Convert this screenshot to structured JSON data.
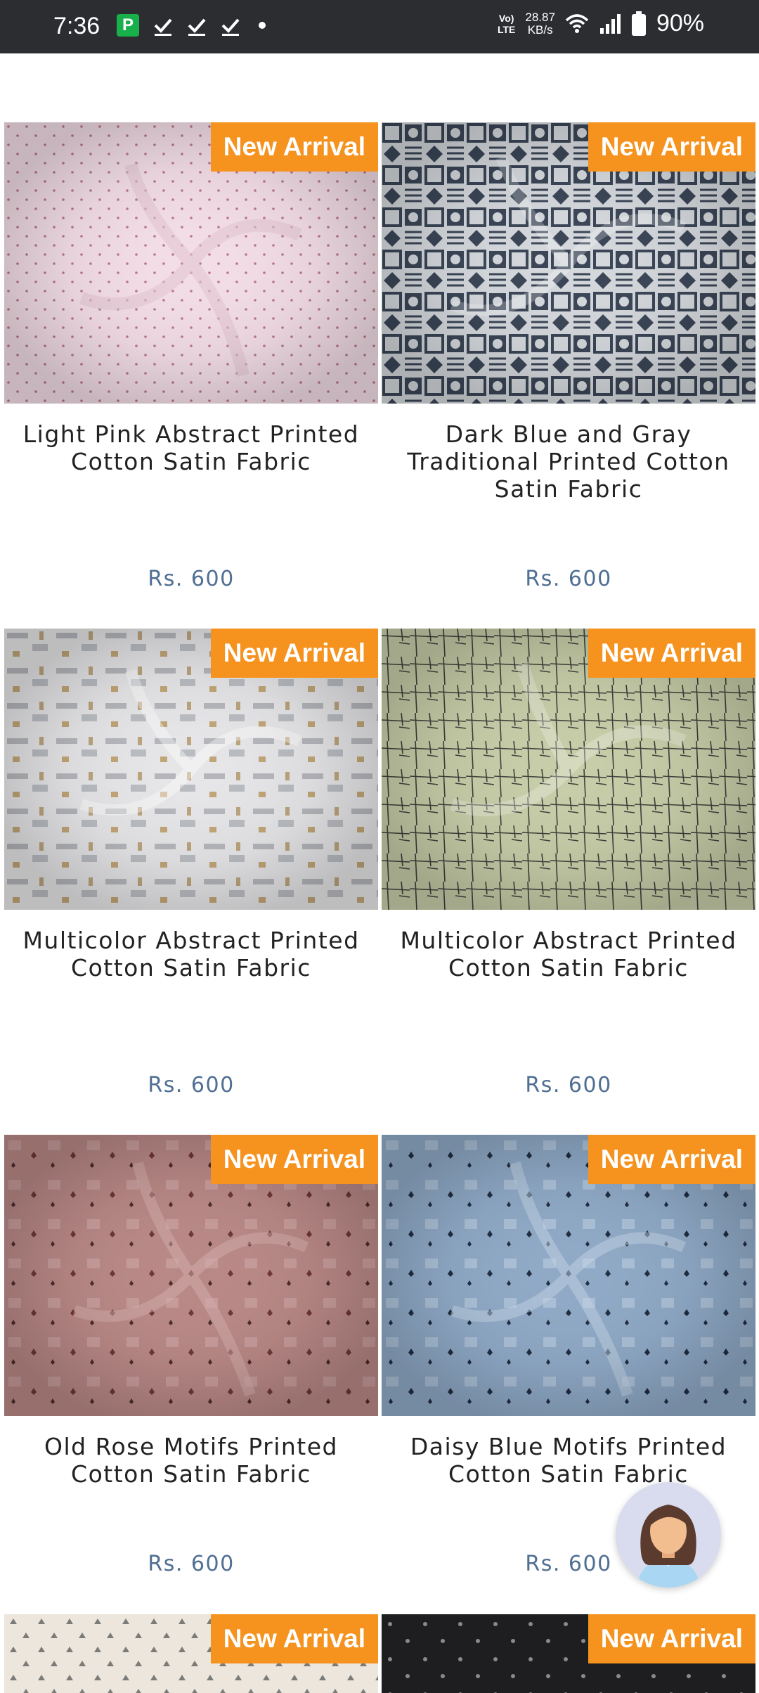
{
  "status_bar": {
    "time": "7:36",
    "app_icon_letter": "P",
    "network_label_top": "Vo)",
    "network_label_bottom": "LTE",
    "speed_value": "28.87",
    "speed_unit": "KB/s",
    "battery": "90%"
  },
  "products": [
    {
      "badge": "New Arrival",
      "title": "Light Pink Abstract Printed Cotton Satin Fabric",
      "price": "Rs. 600"
    },
    {
      "badge": "New Arrival",
      "title": "Dark Blue and Gray Traditional Printed Cotton Satin Fabric",
      "price": "Rs. 600"
    },
    {
      "badge": "New Arrival",
      "title": "Multicolor Abstract Printed Cotton Satin Fabric",
      "price": "Rs. 600"
    },
    {
      "badge": "New Arrival",
      "title": "Multicolor Abstract Printed Cotton Satin Fabric",
      "price": "Rs. 600"
    },
    {
      "badge": "New Arrival",
      "title": "Old Rose Motifs Printed Cotton Satin Fabric",
      "price": "Rs. 600"
    },
    {
      "badge": "New Arrival",
      "title": "Daisy Blue Motifs Printed Cotton Satin Fabric",
      "price": "Rs. 600"
    },
    {
      "badge": "New Arrival",
      "title": "",
      "price": ""
    },
    {
      "badge": "New Arrival",
      "title": "",
      "price": ""
    }
  ],
  "colors": {
    "badge": "#f6921e",
    "price": "#4f6f93",
    "status_bar": "#2b2d31"
  },
  "icons": {
    "chat": "support-agent-avatar-icon"
  }
}
